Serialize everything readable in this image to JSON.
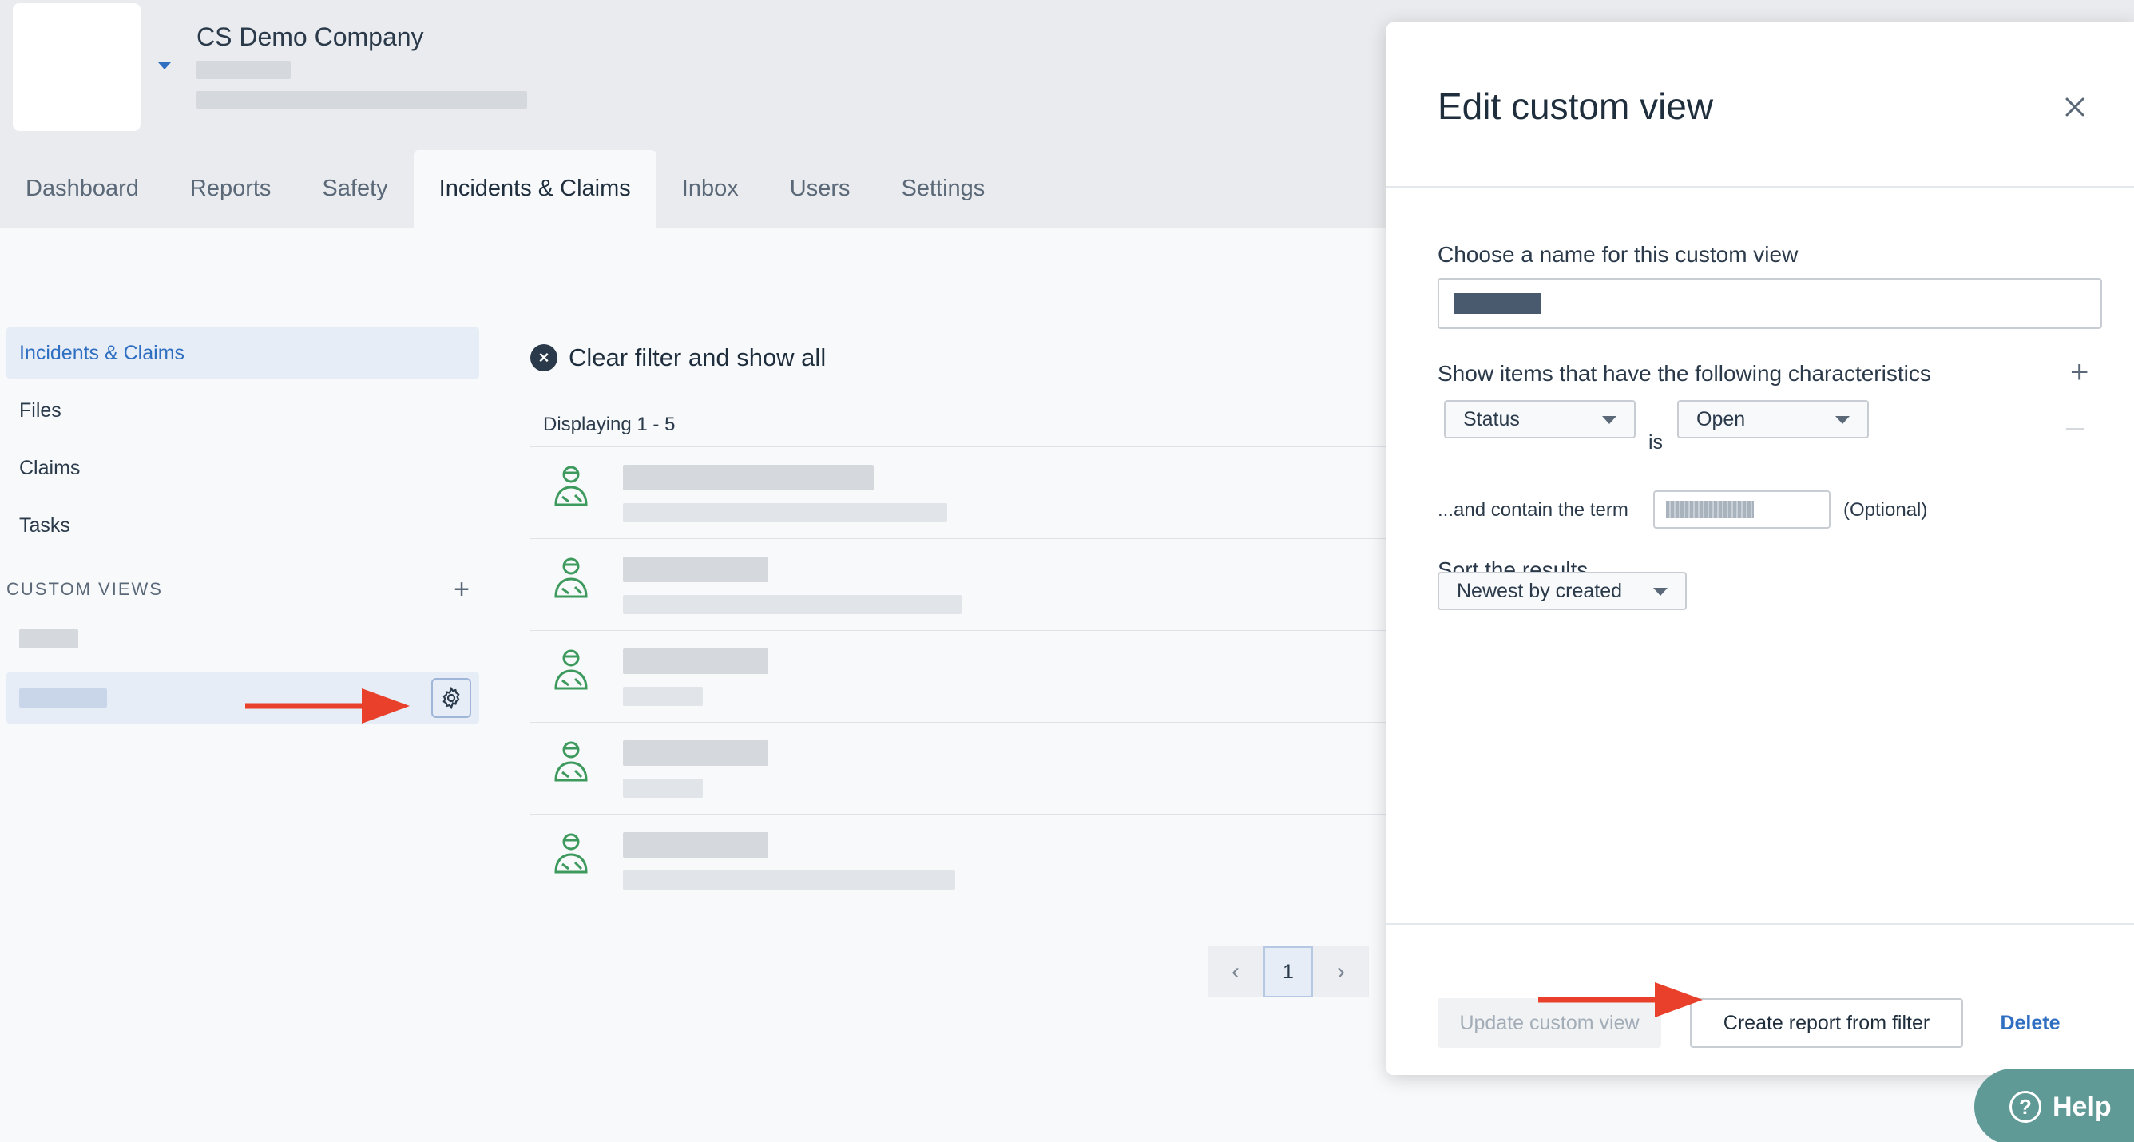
{
  "company": {
    "name": "CS Demo Company"
  },
  "tabs": [
    {
      "label": "Dashboard"
    },
    {
      "label": "Reports"
    },
    {
      "label": "Safety"
    },
    {
      "label": "Incidents & Claims"
    },
    {
      "label": "Inbox"
    },
    {
      "label": "Users"
    },
    {
      "label": "Settings"
    }
  ],
  "sidebar": {
    "items": [
      {
        "label": "Incidents & Claims"
      },
      {
        "label": "Files"
      },
      {
        "label": "Claims"
      },
      {
        "label": "Tasks"
      }
    ],
    "custom_views_label": "CUSTOM VIEWS",
    "add_symbol": "+"
  },
  "main": {
    "clear_filter": "Clear filter and show all",
    "clear_icon": "×",
    "displaying": "Displaying 1 - 5",
    "pager": {
      "prev": "‹",
      "current": "1",
      "next": "›"
    }
  },
  "drawer": {
    "title": "Edit custom view",
    "name_label": "Choose a name for this custom view",
    "characteristics_label": "Show items that have the following characteristics",
    "add_symbol": "+",
    "criterion": {
      "field": "Status",
      "operator": "is",
      "value": "Open"
    },
    "term_label": "...and contain the term",
    "optional": "(Optional)",
    "sort_label": "Sort the results",
    "sort_value": "Newest by created",
    "buttons": {
      "update": "Update custom view",
      "create": "Create report from filter",
      "delete": "Delete"
    }
  },
  "help": {
    "label": "Help",
    "icon": "?"
  },
  "colors": {
    "accent": "#2f6fc1",
    "arrow": "#e8402a",
    "help": "#5f9a96",
    "icon_green": "#3d9a5c"
  }
}
